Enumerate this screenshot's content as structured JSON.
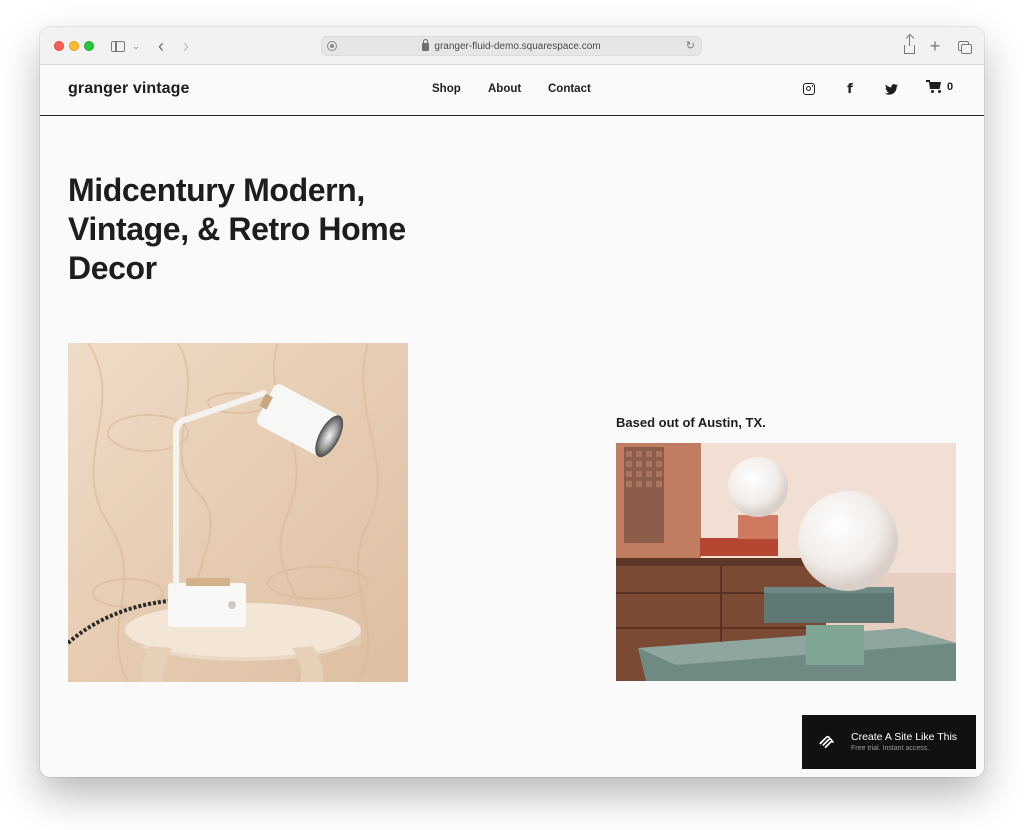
{
  "browser": {
    "url": "granger-fluid-demo.squarespace.com"
  },
  "site": {
    "title": "granger vintage",
    "nav": [
      {
        "label": "Shop"
      },
      {
        "label": "About"
      },
      {
        "label": "Contact"
      }
    ],
    "social": [
      "instagram-icon",
      "facebook-icon",
      "twitter-icon"
    ],
    "cart_count": "0"
  },
  "hero": {
    "heading": "Midcentury Modern, Vintage, & Retro Home Decor"
  },
  "gallery": {
    "location_caption": "Based out of Austin, TX."
  },
  "badge": {
    "title": "Create A Site Like This",
    "subtitle": "Free trial. Instant access."
  },
  "colors": {
    "page_background": "#fafafa",
    "text": "#1d1d1d",
    "badge_background": "#111111"
  }
}
